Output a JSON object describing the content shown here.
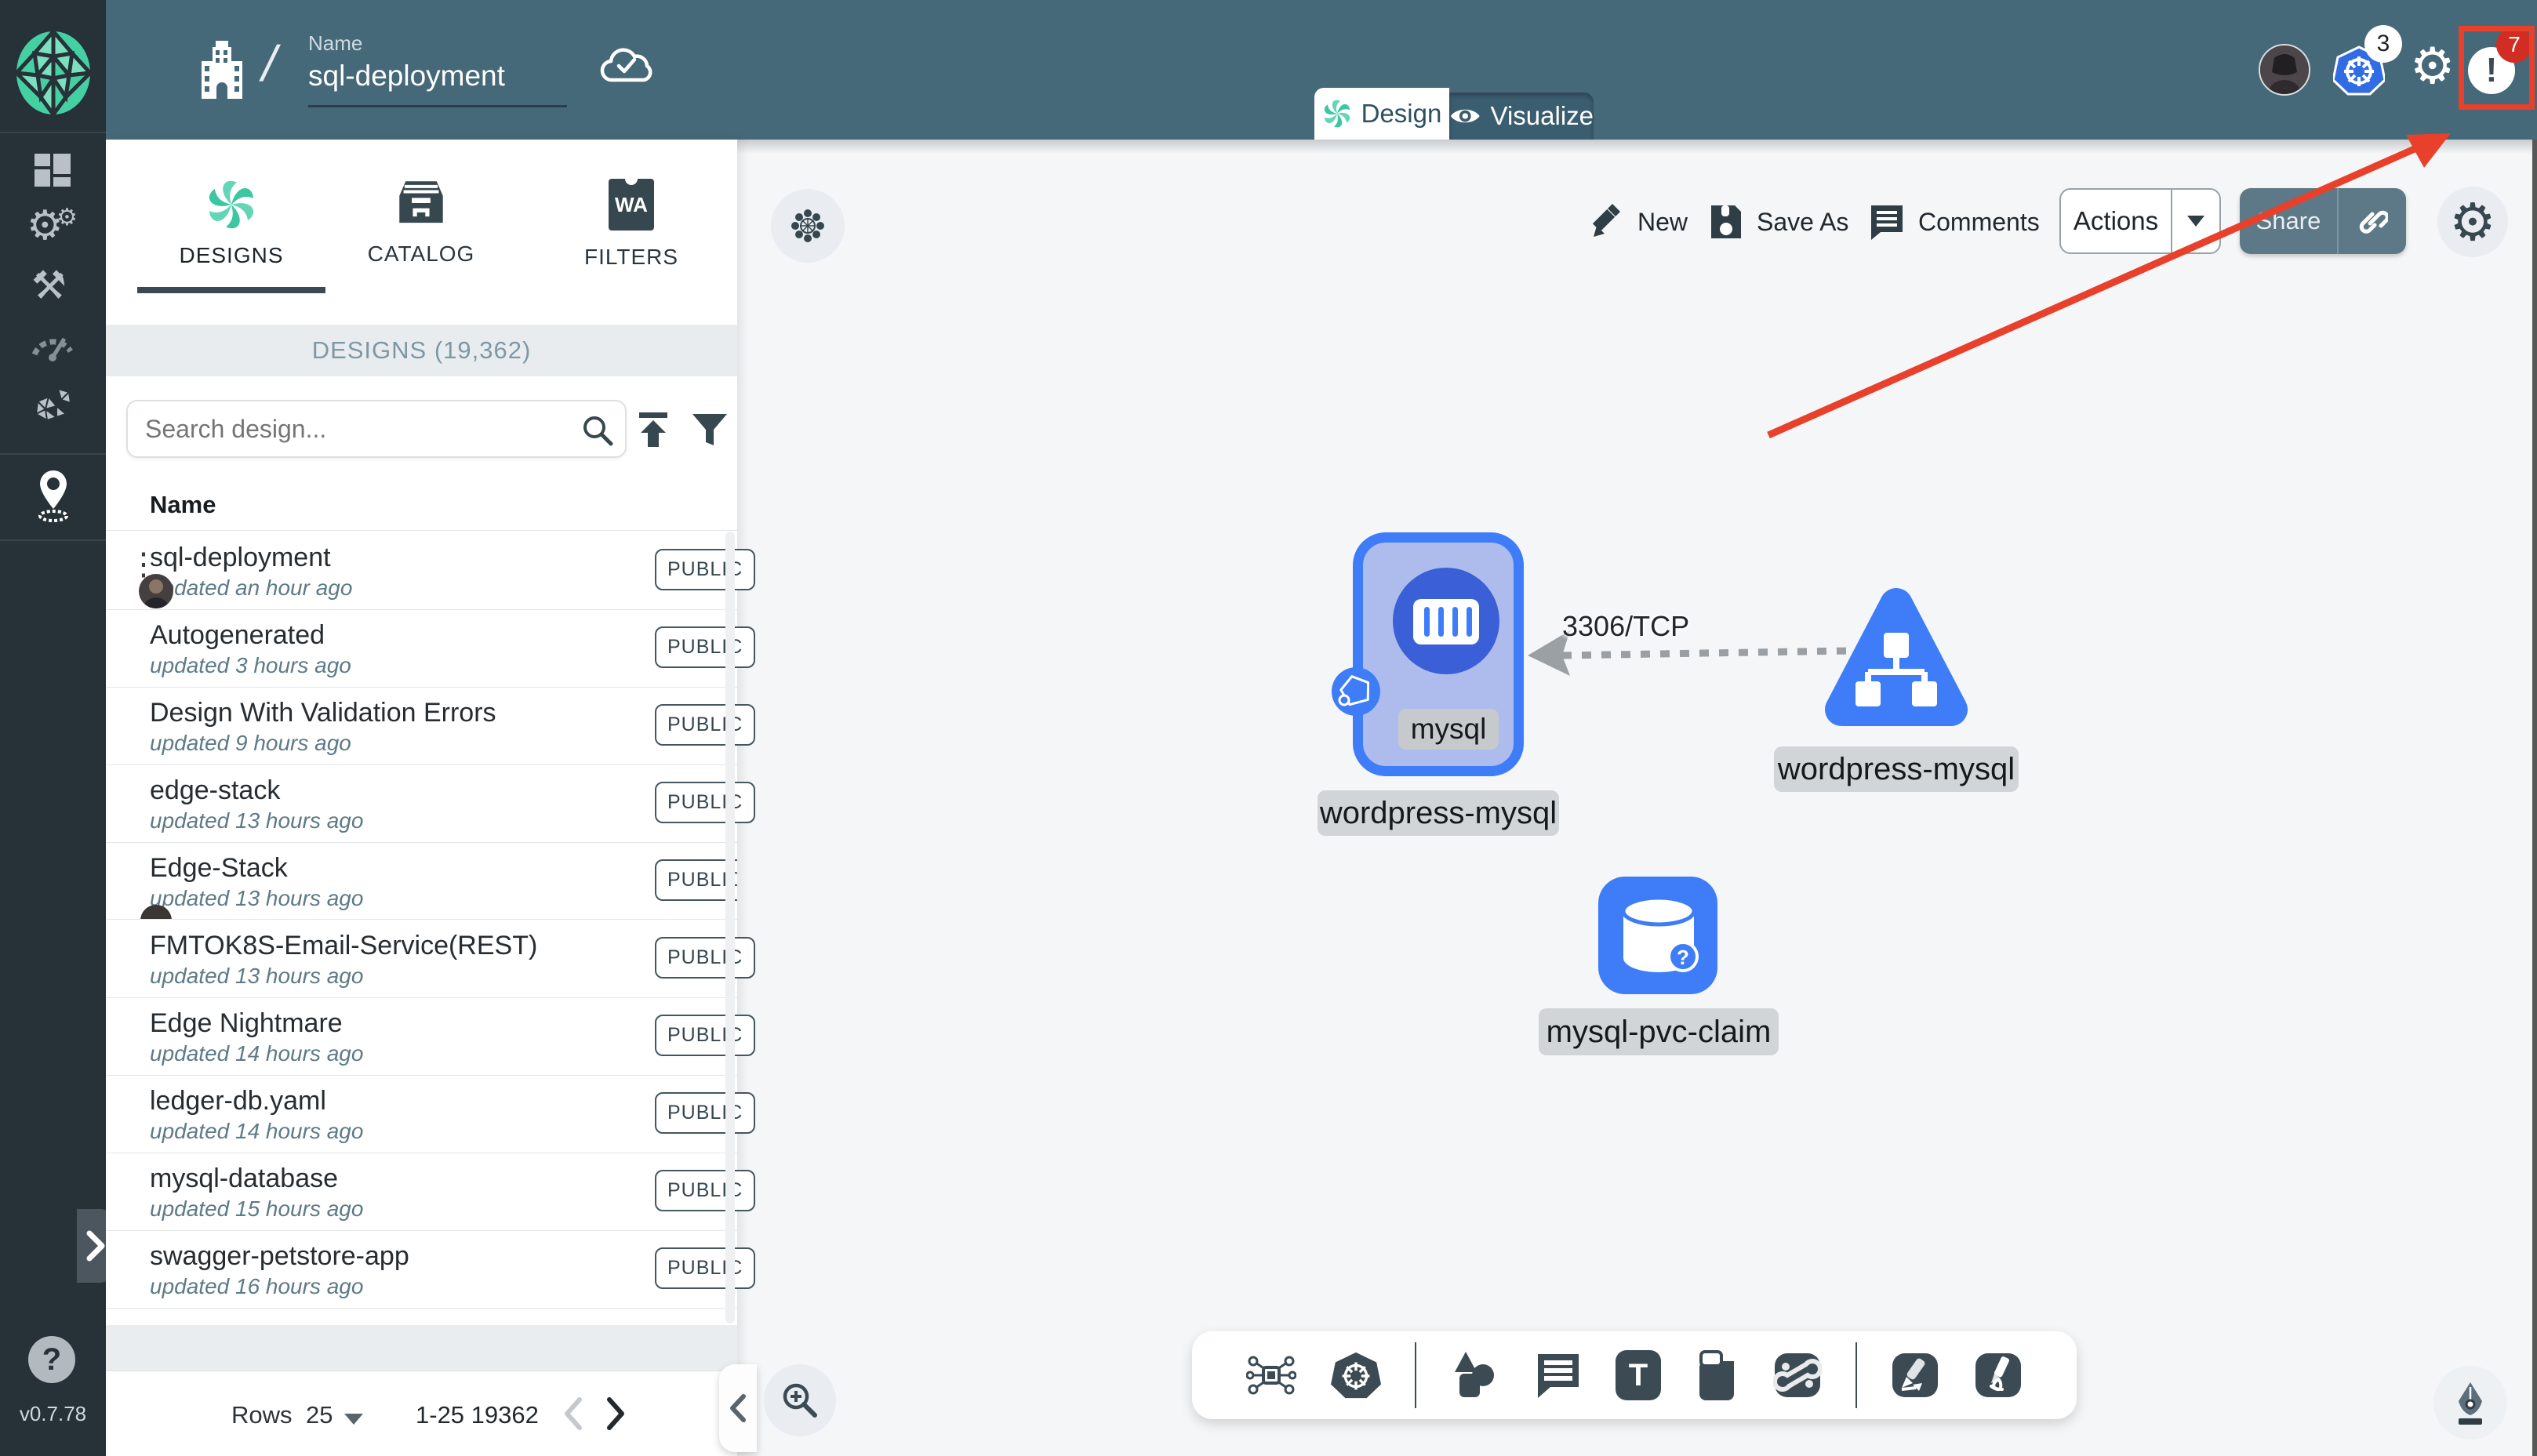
{
  "app": {
    "version": "v0.7.78"
  },
  "header": {
    "name_label": "Name",
    "name_value": "sql-deployment",
    "breadcrumb_sep": "/",
    "k8s_badge": "3",
    "notification_badge": "7",
    "mode": {
      "design": "Design",
      "visualize": "Visualize"
    }
  },
  "panel": {
    "tabs": {
      "designs": "DESIGNS",
      "catalog": "CATALOG",
      "filters": "FILTERS"
    },
    "filters_icon_label": "WA",
    "list_header": "DESIGNS (19,362)",
    "search_placeholder": "Search design...",
    "column_name": "Name",
    "designs": [
      {
        "name": "sql-deployment",
        "updated": "updated an hour ago",
        "visibility": "PUBLIC"
      },
      {
        "name": "Autogenerated",
        "updated": "updated 3 hours ago",
        "visibility": "PUBLIC"
      },
      {
        "name": "Design With Validation Errors",
        "updated": "updated 9 hours ago",
        "visibility": "PUBLIC"
      },
      {
        "name": "edge-stack",
        "updated": "updated 13 hours ago",
        "visibility": "PUBLIC"
      },
      {
        "name": "Edge-Stack",
        "updated": "updated 13 hours ago",
        "visibility": "PUBLIC"
      },
      {
        "name": "FMTOK8S-Email-Service(REST)",
        "updated": "updated 13 hours ago",
        "visibility": "PUBLIC"
      },
      {
        "name": "Edge Nightmare",
        "updated": "updated 14 hours ago",
        "visibility": "PUBLIC"
      },
      {
        "name": "ledger-db.yaml",
        "updated": "updated 14 hours ago",
        "visibility": "PUBLIC"
      },
      {
        "name": "mysql-database",
        "updated": "updated 15 hours ago",
        "visibility": "PUBLIC"
      },
      {
        "name": "swagger-petstore-app",
        "updated": "updated 16 hours ago",
        "visibility": "PUBLIC"
      }
    ],
    "pagination": {
      "rows_label": "Rows",
      "rows_per_page": "25",
      "range": "1-25 19362"
    }
  },
  "canvas": {
    "actions": {
      "new": "New",
      "save_as": "Save As",
      "comments": "Comments",
      "actions": "Actions",
      "share": "Share"
    },
    "nodes": {
      "mysql_container": {
        "label": "mysql",
        "group_label": "wordpress-mysql"
      },
      "service": {
        "label": "wordpress-mysql"
      },
      "pvc": {
        "label": "mysql-pvc-claim",
        "badge": "?"
      }
    },
    "edge_label": "3306/TCP",
    "text_tool_glyph": "T"
  },
  "sidebar": {
    "help_glyph": "?"
  },
  "colors": {
    "header_teal": "#46697a",
    "sidebar_dark": "#263238",
    "node_blue": "#3e7df7",
    "node_fill": "#aebced",
    "annotation_red": "#e8402a",
    "k8s_blue": "#326ce5",
    "brand_green": "#3cc6a2"
  }
}
